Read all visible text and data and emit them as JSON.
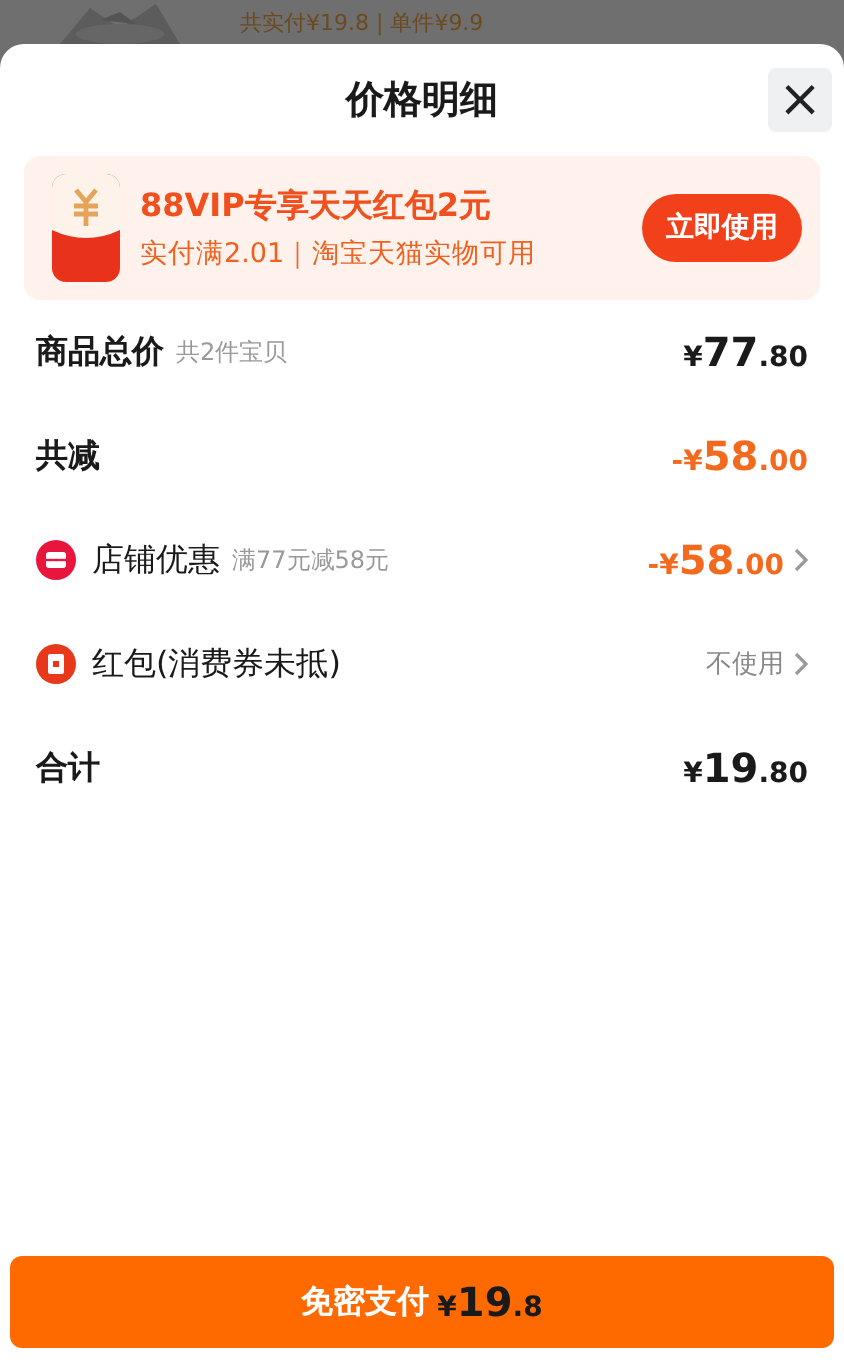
{
  "backdrop": {
    "text": "共实付¥19.8 | 单件¥9.9"
  },
  "sheet": {
    "title": "价格明细",
    "close": "×"
  },
  "promo": {
    "title": "88VIP专享天天红包2元",
    "subtitle": "实付满2.01｜淘宝天猫实物可用",
    "button": "立即使用"
  },
  "rows": [
    {
      "kind": "header",
      "label": "商品总价",
      "note": "共2件宝贝",
      "value": "¥77.80",
      "highlight": false,
      "link": false
    },
    {
      "kind": "header",
      "label": "共减",
      "value": "-¥58.00",
      "highlight": true,
      "link": false
    },
    {
      "kind": "discount",
      "label": "店铺优惠",
      "note": "满77元减58元",
      "value": "-¥58.00",
      "highlight": true,
      "link": true
    },
    {
      "kind": "packet",
      "label": "红包(消费券未抵)",
      "value": "不使用",
      "highlight": false,
      "link": true
    },
    {
      "kind": "header",
      "label": "合计",
      "value": "¥19.80",
      "highlight": false,
      "link": false
    }
  ],
  "pay_button": {
    "label": "免密支付",
    "amount": "¥19.8"
  }
}
